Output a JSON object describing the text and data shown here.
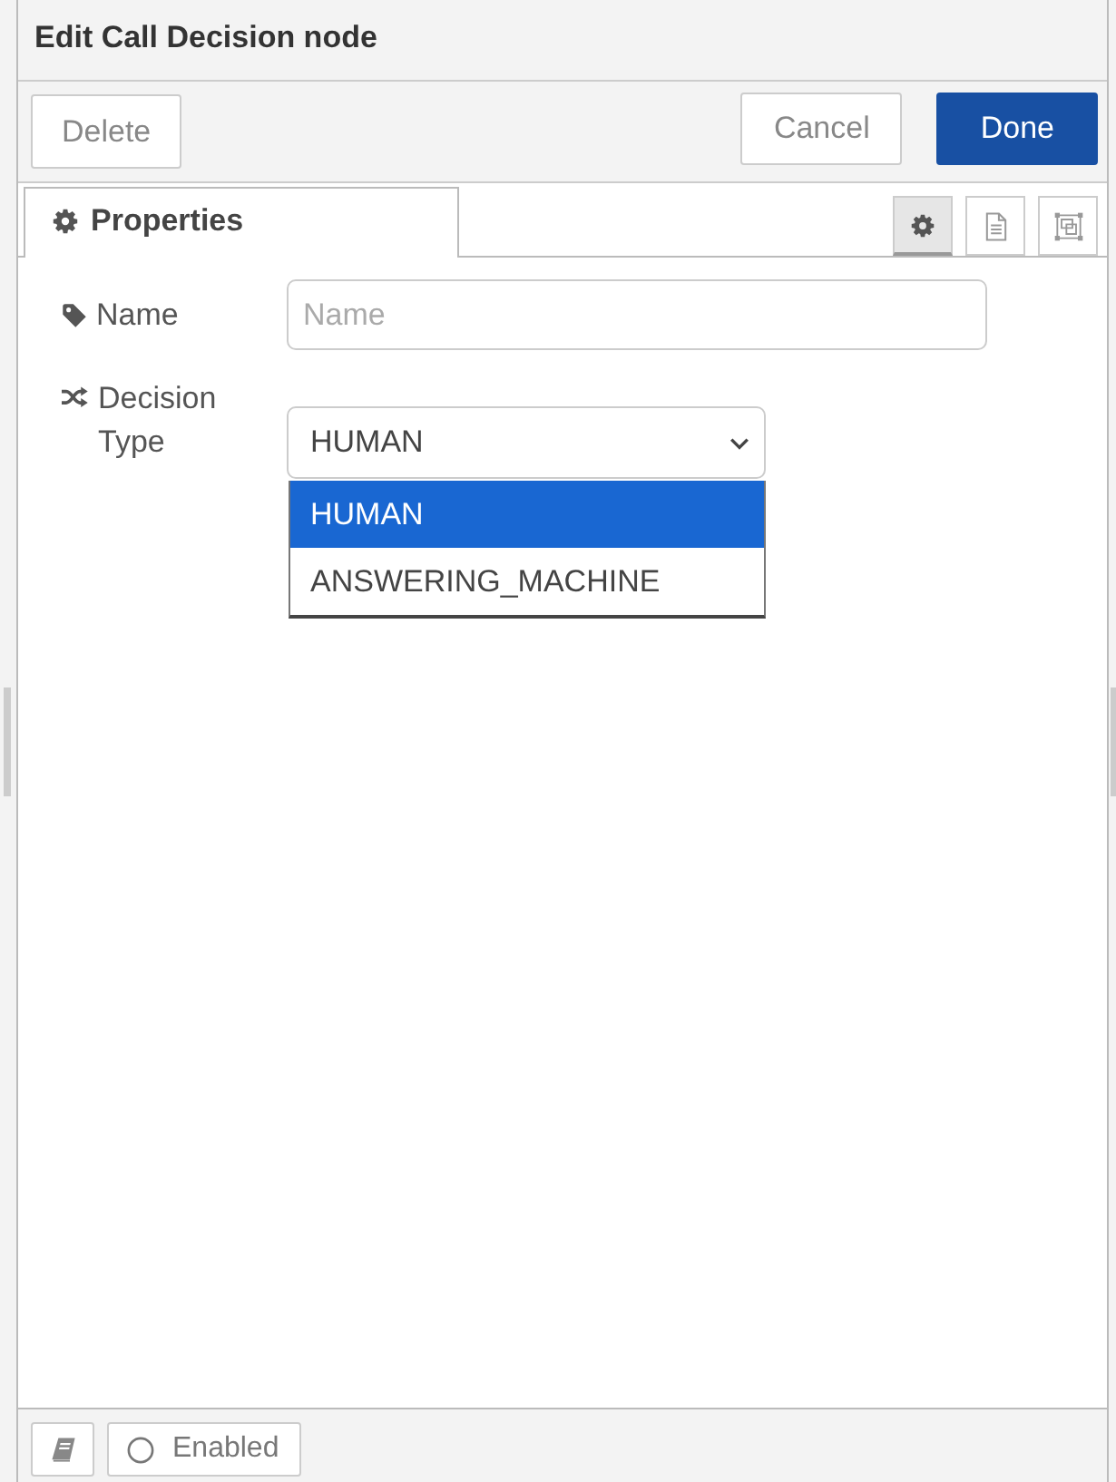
{
  "window": {
    "title": "Edit Call Decision node"
  },
  "toolbar": {
    "left": [
      {
        "kind": "delete",
        "label": "Delete"
      }
    ],
    "right": [
      {
        "kind": "cancel",
        "label": "Cancel"
      },
      {
        "kind": "done",
        "label": "Done"
      }
    ]
  },
  "tabs": [
    {
      "label": "Properties",
      "selected": true
    }
  ],
  "side_buttons": [
    {
      "kind": "settings",
      "selected": true
    },
    {
      "kind": "document",
      "selected": false
    },
    {
      "kind": "frame",
      "selected": false
    }
  ],
  "form": {
    "fields": [
      {
        "kind": "text",
        "label": "Name",
        "placeholder": "Name"
      },
      {
        "kind": "select",
        "label": "Decision Type",
        "value": "HUMAN",
        "expanded": true,
        "options": [
          {
            "label": "HUMAN",
            "selected": true
          },
          {
            "label": "ANSWERING_MACHINE",
            "selected": false
          }
        ]
      }
    ]
  },
  "footer": {
    "buttons": [
      {
        "kind": "info"
      },
      {
        "kind": "toggle",
        "label": "Enabled",
        "on": true
      }
    ]
  }
}
